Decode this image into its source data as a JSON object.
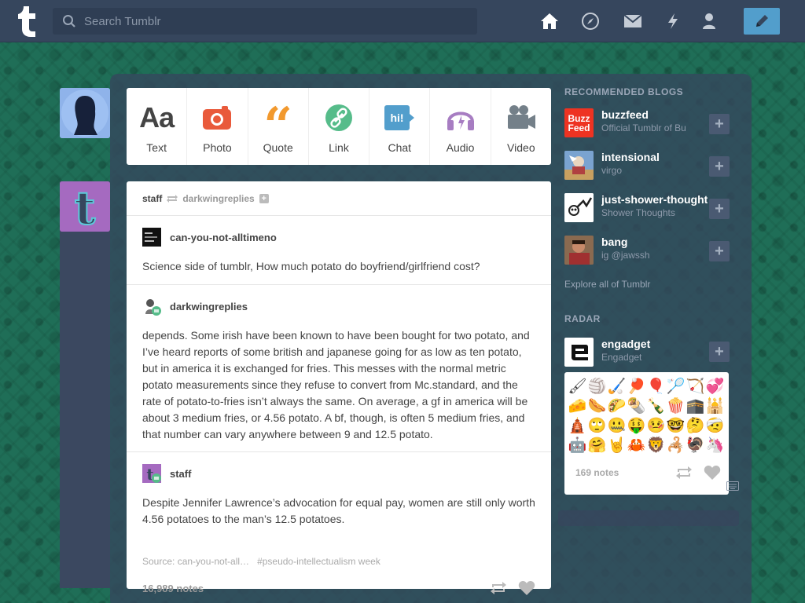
{
  "header": {
    "search_placeholder": "Search Tumblr",
    "nav": [
      "home-icon",
      "explore-icon",
      "inbox-icon",
      "activity-icon",
      "account-icon"
    ],
    "compose_icon": "pencil-icon"
  },
  "colors": {
    "header_bg": "#36465d",
    "compose": "#529ecc",
    "photo": "#e95a3b",
    "quote": "#f2992e",
    "link": "#56bc8a",
    "chat": "#529ecc",
    "audio": "#a77dc2",
    "video": "#748089"
  },
  "post_types": [
    {
      "label": "Text",
      "icon": "text-icon"
    },
    {
      "label": "Photo",
      "icon": "camera-icon"
    },
    {
      "label": "Quote",
      "icon": "quote-icon"
    },
    {
      "label": "Link",
      "icon": "link-icon"
    },
    {
      "label": "Chat",
      "icon": "chat-icon"
    },
    {
      "label": "Audio",
      "icon": "headphones-icon"
    },
    {
      "label": "Video",
      "icon": "video-camera-icon"
    }
  ],
  "post": {
    "author": "staff",
    "reblogged_from": "darkwingreplies",
    "entries": [
      {
        "blog": "can-you-not-alltimeno",
        "text": "Science side of tumblr, How much potato do boyfriend/girlfriend cost?"
      },
      {
        "blog": "darkwingreplies",
        "text": "depends. Some irish have been known to have been bought for two potato, and I’ve heard reports of some british and japanese going for as low as ten potato, but in america it is exchanged for fries. This messes with the normal metric potato measurements since they refuse to convert from Mc.standard, and the rate of potato-to-fries isn’t always the same. On average, a gf in america will be about 3 medium fries, or 4.56 potato. A bf, though, is often 5 medium fries, and that number can vary anywhere between 9 and 12.5 potato."
      },
      {
        "blog": "staff",
        "text": "Despite Jennifer Lawrence’s advocation for equal pay, women are still only worth 4.56 potatoes to the man’s 12.5 potatoes."
      }
    ],
    "source": "Source: can-you-not-all…",
    "tag": "#pseudo-intellectualism week",
    "notes": "16,989 notes"
  },
  "sidebar": {
    "recommended_title": "RECOMMENDED BLOGS",
    "blogs": [
      {
        "name": "buzzfeed",
        "sub": "Official Tumblr of Bu"
      },
      {
        "name": "intensional",
        "sub": "virgo"
      },
      {
        "name": "just-shower-thoughts",
        "sub": "Shower Thoughts"
      },
      {
        "name": "bang",
        "sub": "ig @jawssh"
      }
    ],
    "explore": "Explore all of Tumblr",
    "radar_title": "RADAR",
    "radar_blog": {
      "name": "engadget",
      "sub": "Engadget"
    },
    "radar_notes": "169 notes",
    "buzzfeed_logo_text": "Buzz Feed"
  }
}
